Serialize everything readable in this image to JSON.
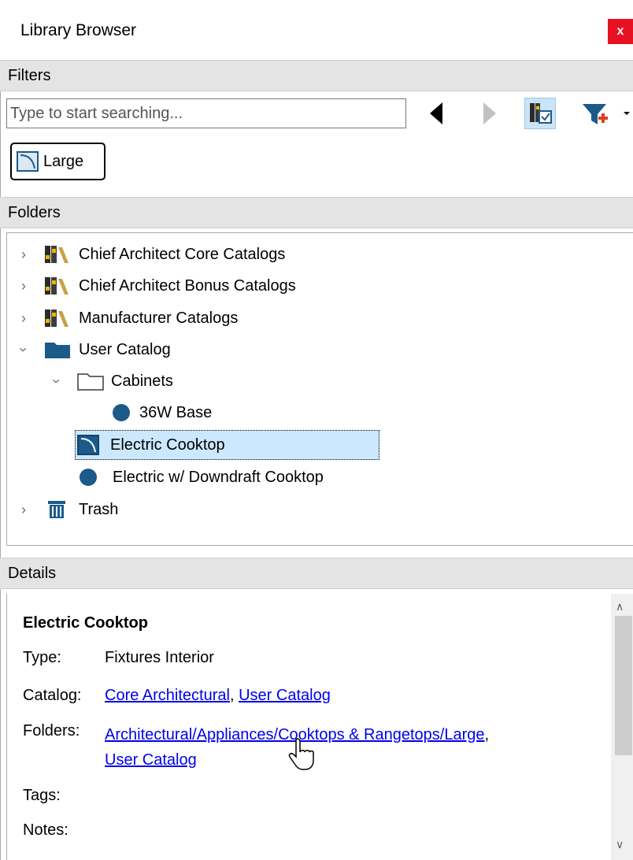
{
  "window": {
    "title": "Library Browser",
    "close_label": "x"
  },
  "filters": {
    "header": "Filters",
    "search_placeholder": "Type to start searching...",
    "active_filter_chip": "Large",
    "icons": [
      "back-arrow-icon",
      "forward-arrow-icon",
      "catalog-toggle-icon",
      "add-filter-icon"
    ]
  },
  "folders": {
    "header": "Folders",
    "items": [
      {
        "label": "Chief Architect Core Catalogs",
        "icon": "books-icon",
        "expanded": false
      },
      {
        "label": "Chief Architect Bonus Catalogs",
        "icon": "books-icon",
        "expanded": false
      },
      {
        "label": "Manufacturer Catalogs",
        "icon": "books-icon",
        "expanded": false
      },
      {
        "label": "User Catalog",
        "icon": "folder-filled-icon",
        "expanded": true
      },
      {
        "label": "Cabinets",
        "icon": "folder-outline-icon",
        "expanded": true
      },
      {
        "label": "36W Base",
        "icon": "object-dot-icon"
      },
      {
        "label": "Electric Cooktop",
        "icon": "cooktop-icon",
        "selected": true
      },
      {
        "label": "Electric w/ Downdraft Cooktop",
        "icon": "object-dot-icon"
      },
      {
        "label": "Trash",
        "icon": "trash-icon",
        "expanded": false
      }
    ]
  },
  "details": {
    "header": "Details",
    "title": "Electric Cooktop",
    "type_label": "Type:",
    "type_value": "Fixtures Interior",
    "catalog_label": "Catalog:",
    "catalog_links": [
      "Core Architectural",
      "User Catalog"
    ],
    "folders_label": "Folders:",
    "folder_links": [
      "Architectural/Appliances/Cooktops & Rangetops/Large",
      "User Catalog"
    ],
    "tags_label": "Tags:",
    "notes_label": "Notes:"
  },
  "colors": {
    "accent": "#1c5a8a",
    "selection": "#cce8ff",
    "header_bg": "#e4e4e4",
    "close_red": "#e81123",
    "link": "#0000ee"
  }
}
